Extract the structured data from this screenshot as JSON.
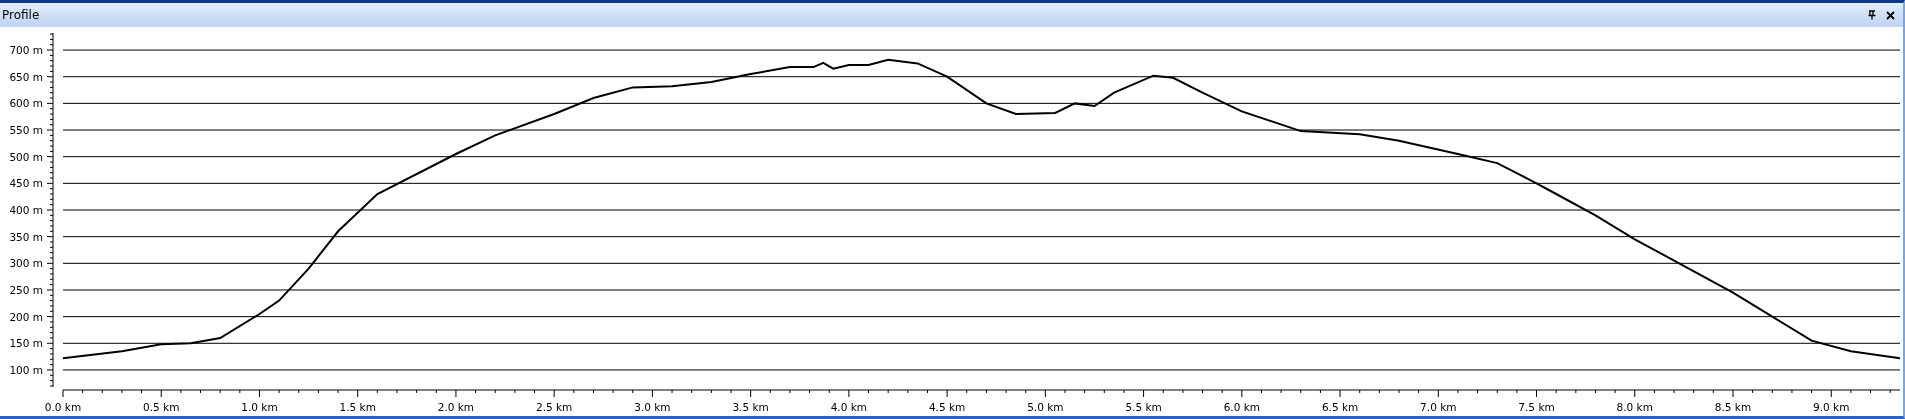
{
  "panel": {
    "title": "Profile"
  },
  "chart_data": {
    "type": "line",
    "xlim": [
      0,
      9.35
    ],
    "ylim": [
      68,
      732
    ],
    "grid": true,
    "x": [
      0,
      0.3,
      0.5,
      0.65,
      0.8,
      1.0,
      1.1,
      1.25,
      1.4,
      1.6,
      2.0,
      2.2,
      2.5,
      2.7,
      2.9,
      3.1,
      3.3,
      3.5,
      3.7,
      3.82,
      3.87,
      3.92,
      4.0,
      4.1,
      4.2,
      4.35,
      4.5,
      4.7,
      4.85,
      5.05,
      5.15,
      5.25,
      5.35,
      5.55,
      5.65,
      5.8,
      6.0,
      6.3,
      6.6,
      6.8,
      7.1,
      7.3,
      7.5,
      7.6,
      7.8,
      8.0,
      8.2,
      8.5,
      8.7,
      8.9,
      9.1,
      9.35
    ],
    "series": [
      {
        "color": "#000000",
        "values": [
          122,
          135,
          148,
          150,
          160,
          205,
          230,
          290,
          360,
          430,
          505,
          540,
          580,
          610,
          630,
          632,
          640,
          655,
          668,
          668,
          676,
          665,
          672,
          672,
          682,
          675,
          650,
          600,
          580,
          582,
          600,
          595,
          620,
          652,
          648,
          620,
          585,
          548,
          542,
          530,
          505,
          488,
          450,
          430,
          390,
          345,
          305,
          245,
          200,
          155,
          135,
          122
        ]
      }
    ],
    "xticks": [
      {
        "value": 0,
        "label": "0.0 km"
      },
      {
        "value": 0.5,
        "label": "0.5 km"
      },
      {
        "value": 1,
        "label": "1.0 km"
      },
      {
        "value": 1.5,
        "label": "1.5 km"
      },
      {
        "value": 2,
        "label": "2.0 km"
      },
      {
        "value": 2.5,
        "label": "2.5 km"
      },
      {
        "value": 3,
        "label": "3.0 km"
      },
      {
        "value": 3.5,
        "label": "3.5 km"
      },
      {
        "value": 4,
        "label": "4.0 km"
      },
      {
        "value": 4.5,
        "label": "4.5 km"
      },
      {
        "value": 5,
        "label": "5.0 km"
      },
      {
        "value": 5.5,
        "label": "5.5 km"
      },
      {
        "value": 6,
        "label": "6.0 km"
      },
      {
        "value": 6.5,
        "label": "6.5 km"
      },
      {
        "value": 7,
        "label": "7.0 km"
      },
      {
        "value": 7.5,
        "label": "7.5 km"
      },
      {
        "value": 8,
        "label": "8.0 km"
      },
      {
        "value": 8.5,
        "label": "8.5 km"
      },
      {
        "value": 9,
        "label": "9.0 km"
      }
    ],
    "yticks": [
      {
        "value": 100,
        "label": "100 m"
      },
      {
        "value": 150,
        "label": "150 m"
      },
      {
        "value": 200,
        "label": "200 m"
      },
      {
        "value": 250,
        "label": "250 m"
      },
      {
        "value": 300,
        "label": "300 m"
      },
      {
        "value": 350,
        "label": "350 m"
      },
      {
        "value": 400,
        "label": "400 m"
      },
      {
        "value": 450,
        "label": "450 m"
      },
      {
        "value": 500,
        "label": "500 m"
      },
      {
        "value": 550,
        "label": "550 m"
      },
      {
        "value": 600,
        "label": "600 m"
      },
      {
        "value": 650,
        "label": "650 m"
      },
      {
        "value": 700,
        "label": "700 m"
      }
    ]
  }
}
